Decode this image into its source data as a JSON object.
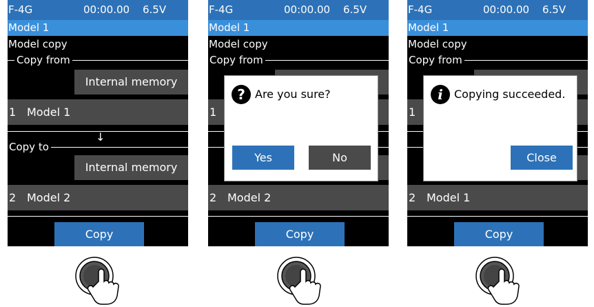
{
  "screens": [
    {
      "status": {
        "model": "F-4G",
        "time": "00:00.00",
        "voltage": "6.5V"
      },
      "model_bar": "Model 1",
      "title": "Model copy",
      "copy_from": {
        "label": "Copy from",
        "memory": "Internal memory",
        "num": "1",
        "name": "Model 1"
      },
      "arrow": "↓",
      "copy_to": {
        "label": "Copy to",
        "memory": "Internal memory",
        "num": "2",
        "name": "Model 2"
      },
      "copy_button": "Copy"
    },
    {
      "status": {
        "model": "F-4G",
        "time": "00:00.00",
        "voltage": "6.5V"
      },
      "model_bar": "Model 1",
      "title": "Model copy",
      "copy_from": {
        "label": "Copy from",
        "num": "1"
      },
      "copy_to": {
        "num": "2",
        "name": "Model 2"
      },
      "copy_button": "Copy",
      "dialog": {
        "icon": "question-icon",
        "message": "Are you sure?",
        "yes": "Yes",
        "no": "No"
      }
    },
    {
      "status": {
        "model": "F-4G",
        "time": "00:00.00",
        "voltage": "6.5V"
      },
      "model_bar": "Model 1",
      "title": "Model copy",
      "copy_from": {
        "label": "Copy from",
        "num": "1"
      },
      "copy_to": {
        "num": "2",
        "name": "Model 1"
      },
      "copy_button": "Copy",
      "dialog": {
        "icon": "info-icon",
        "message": "Copying succeeded.",
        "close": "Close"
      }
    }
  ],
  "colors": {
    "status_bar": "#2d72b8",
    "model_bar": "#3a8fdb",
    "button": "#2d72b8",
    "row": "#4a4a4a",
    "dialog_no": "#4a4a4a"
  },
  "dial_icon": "dial-press-icon"
}
